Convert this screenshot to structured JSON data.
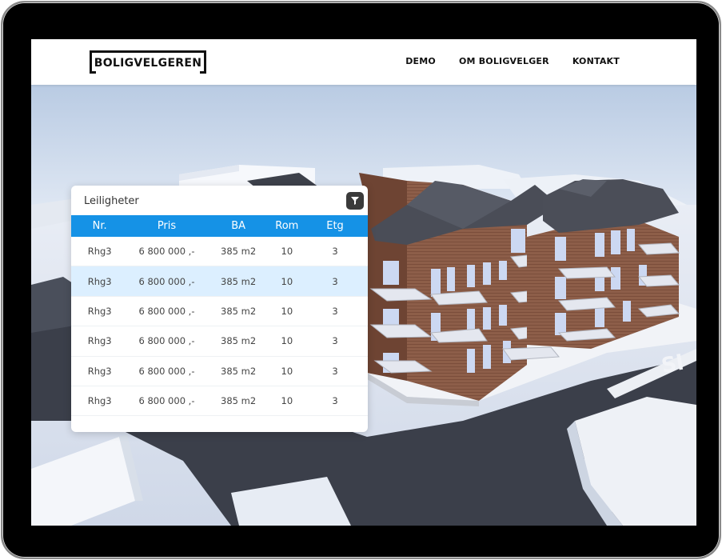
{
  "header": {
    "logo_text": "BOLIGVELGEREN",
    "nav": [
      {
        "label": "DEMO"
      },
      {
        "label": "OM BOLIGVELGER"
      },
      {
        "label": "KONTAKT"
      }
    ]
  },
  "scene": {
    "street_sign_text": "Sl"
  },
  "panel": {
    "title": "Leiligheter",
    "filter_icon": "filter-icon",
    "columns": [
      "Nr.",
      "Pris",
      "BA",
      "Rom",
      "Etg"
    ],
    "rows": [
      {
        "nr": "Rhg3",
        "pris": "6 800 000 ,-",
        "ba": "385 m2",
        "rom": "10",
        "etg": "3",
        "selected": false
      },
      {
        "nr": "Rhg3",
        "pris": "6 800 000 ,-",
        "ba": "385 m2",
        "rom": "10",
        "etg": "3",
        "selected": true
      },
      {
        "nr": "Rhg3",
        "pris": "6 800 000 ,-",
        "ba": "385 m2",
        "rom": "10",
        "etg": "3",
        "selected": false
      },
      {
        "nr": "Rhg3",
        "pris": "6 800 000 ,-",
        "ba": "385 m2",
        "rom": "10",
        "etg": "3",
        "selected": false
      },
      {
        "nr": "Rhg3",
        "pris": "6 800 000 ,-",
        "ba": "385 m2",
        "rom": "10",
        "etg": "3",
        "selected": false
      },
      {
        "nr": "Rhg3",
        "pris": "6 800 000 ,-",
        "ba": "385 m2",
        "rom": "10",
        "etg": "3",
        "selected": false
      }
    ]
  },
  "colors": {
    "accent": "#1592e6",
    "selected_row": "#dcefff",
    "brick": "#8a5a45",
    "road": "#3b3f4a"
  }
}
